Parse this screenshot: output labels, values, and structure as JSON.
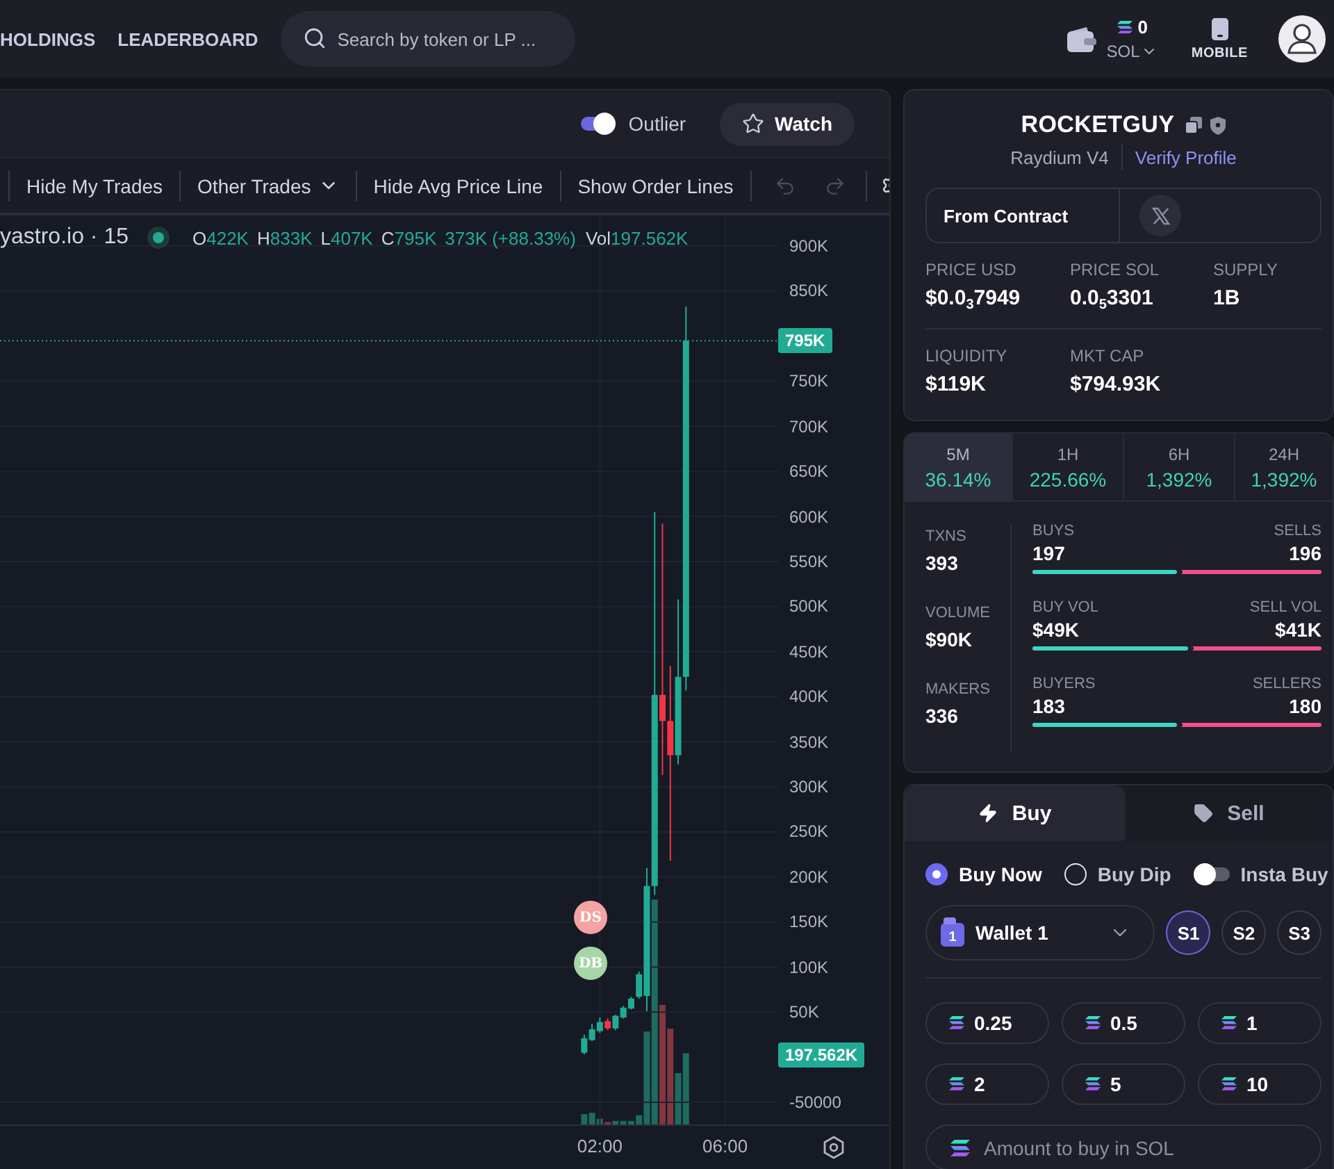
{
  "top_bar": {
    "nav": [
      {
        "label": "HOLDINGS"
      },
      {
        "label": "LEADERBOARD"
      }
    ],
    "search": {
      "placeholder": "Search by token or LP ..."
    },
    "wallet": {
      "balance": "0",
      "currency": "SOL"
    },
    "mobile": {
      "label": "MOBILE"
    }
  },
  "chart_panel": {
    "outlier": {
      "label": "Outlier",
      "on": true
    },
    "watch": {
      "label": "Watch"
    },
    "toolbar": [
      {
        "kind": "button",
        "label": "Hide My Trades"
      },
      {
        "kind": "dropdown",
        "label": "Other Trades"
      },
      {
        "kind": "button",
        "label": "Hide Avg Price Line"
      },
      {
        "kind": "button",
        "label": "Show Order Lines"
      },
      {
        "kind": "undo",
        "disabled": true
      },
      {
        "kind": "redo",
        "disabled": true
      },
      {
        "kind": "settings"
      }
    ],
    "legend": {
      "symbol": "yastro.io · 15",
      "ohlc": [
        {
          "key": "O",
          "value": "422K"
        },
        {
          "key": "H",
          "value": "833K"
        },
        {
          "key": "L",
          "value": "407K"
        },
        {
          "key": "C",
          "value": "795K"
        }
      ],
      "change": "373K (+88.33%)",
      "volume": {
        "key": "Vol",
        "value": "197.562K"
      }
    },
    "chart_data": {
      "type": "candlestick",
      "x": [
        1.5,
        1.75,
        2,
        2.25,
        2.5,
        2.75,
        3,
        3.25,
        3.5,
        3.75,
        4,
        4.25,
        4.5,
        4.75
      ],
      "ohlc": [
        [
          5000,
          25000,
          3000,
          21000
        ],
        [
          19000,
          37000,
          18000,
          31000
        ],
        [
          29000,
          44000,
          27000,
          39000
        ],
        [
          40000,
          43000,
          30000,
          32000
        ],
        [
          32000,
          47000,
          30000,
          46000
        ],
        [
          44000,
          57000,
          43000,
          55000
        ],
        [
          54000,
          67000,
          53000,
          65000
        ],
        [
          67000,
          95000,
          65000,
          92000
        ],
        [
          68000,
          210000,
          51000,
          190000
        ],
        [
          190000,
          605000,
          180000,
          402000
        ],
        [
          402000,
          592000,
          313000,
          373000
        ],
        [
          373000,
          434000,
          218000,
          335000
        ],
        [
          335000,
          508000,
          325000,
          422000
        ],
        [
          422000,
          833000,
          407000,
          795000
        ]
      ],
      "xlim": [
        -17.16,
        11.29
      ],
      "ylim": [
        -74675,
        933929
      ],
      "xticks": [
        {
          "value": 2,
          "label": "02:00"
        },
        {
          "value": 6,
          "label": "06:00"
        }
      ],
      "yticks": [
        {
          "value": 900000,
          "label": "900K"
        },
        {
          "value": 850000,
          "label": "850K"
        },
        {
          "value": 750000,
          "label": "750K"
        },
        {
          "value": 700000,
          "label": "700K"
        },
        {
          "value": 650000,
          "label": "650K"
        },
        {
          "value": 600000,
          "label": "600K"
        },
        {
          "value": 550000,
          "label": "550K"
        },
        {
          "value": 500000,
          "label": "500K"
        },
        {
          "value": 450000,
          "label": "450K"
        },
        {
          "value": 400000,
          "label": "400K"
        },
        {
          "value": 350000,
          "label": "350K"
        },
        {
          "value": 300000,
          "label": "300K"
        },
        {
          "value": 250000,
          "label": "250K"
        },
        {
          "value": 200000,
          "label": "200K"
        },
        {
          "value": 150000,
          "label": "150K"
        },
        {
          "value": 100000,
          "label": "100K"
        },
        {
          "value": 50000,
          "label": "50K"
        },
        {
          "value": -50000,
          "label": "-50000"
        }
      ],
      "grid": true,
      "ref_lines": [
        {
          "axis": "y",
          "value": 795000,
          "label": "795K"
        }
      ]
    },
    "volume": {
      "last_value": "197.562K"
    },
    "trade_markers": [
      {
        "label": "DS",
        "color": "#f5a3a3"
      },
      {
        "label": "DB",
        "color": "#a6d5a6"
      }
    ]
  },
  "token": {
    "name": "ROCKETGUY",
    "dex": "Raydium V4",
    "verify_link": "Verify Profile",
    "contract_label": "From Contract",
    "stat_rows": [
      [
        {
          "label": "PRICE USD",
          "value": "$0.0$_{3}$7949"
        },
        {
          "label": "PRICE SOL",
          "value": "0.0$_{5}$3301"
        },
        {
          "label": "SUPPLY",
          "value": "1B"
        }
      ],
      [
        {
          "label": "LIQUIDITY",
          "value": "$119K"
        },
        {
          "label": "MKT CAP",
          "value": "$794.93K"
        }
      ]
    ]
  },
  "activity": {
    "timeframes": [
      {
        "label": "5M",
        "value": "36.14%",
        "selected": true
      },
      {
        "label": "1H",
        "value": "225.66%",
        "selected": false
      },
      {
        "label": "6H",
        "value": "1,392%",
        "selected": false
      },
      {
        "label": "24H",
        "value": "1,392%",
        "selected": false
      }
    ],
    "totals": [
      {
        "label": "TXNS",
        "value": "393"
      },
      {
        "label": "VOLUME",
        "value": "$90K"
      },
      {
        "label": "MAKERS",
        "value": "336"
      }
    ],
    "splits": [
      {
        "buy_label": "BUYS",
        "buy_value": "197",
        "sell_label": "SELLS",
        "sell_value": "196",
        "level": 0.5
      },
      {
        "buy_label": "BUY VOL",
        "buy_value": "$49K",
        "sell_label": "SELL VOL",
        "sell_value": "$41K",
        "level": 0.54
      },
      {
        "buy_label": "BUYERS",
        "buy_value": "183",
        "sell_label": "SELLERS",
        "sell_value": "180",
        "level": 0.5
      }
    ]
  },
  "trade": {
    "tabs": [
      {
        "kind": "buy",
        "label": "Buy",
        "selected": true
      },
      {
        "kind": "sell",
        "label": "Sell",
        "selected": false
      }
    ],
    "order_options": [
      {
        "kind": "radio",
        "label": "Buy Now",
        "selected": true
      },
      {
        "kind": "radio",
        "label": "Buy Dip",
        "selected": false
      },
      {
        "kind": "toggle",
        "label": "Insta Buy",
        "on": false
      }
    ],
    "wallet": {
      "badge": "1",
      "label": "Wallet 1"
    },
    "slots": [
      {
        "label": "S1",
        "selected": true
      },
      {
        "label": "S2",
        "selected": false
      },
      {
        "label": "S3",
        "selected": false
      }
    ],
    "amounts": [
      "0.25",
      "0.5",
      "1",
      "2",
      "5",
      "10"
    ],
    "amount_input": {
      "placeholder": "Amount to buy in SOL"
    }
  }
}
